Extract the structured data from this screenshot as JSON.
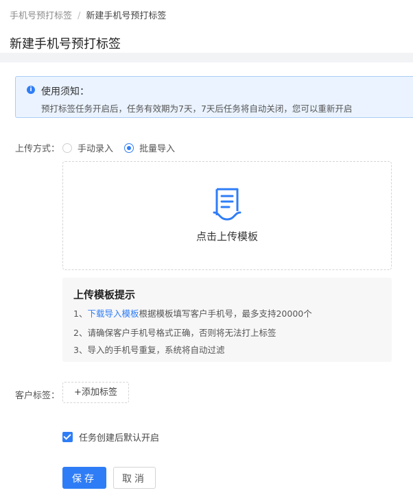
{
  "breadcrumb": {
    "parent": "手机号预打标签",
    "separator": "/",
    "current": "新建手机号预打标签"
  },
  "page_title": "新建手机号预打标签",
  "notice": {
    "icon": "info-icon",
    "title": "使用须知：",
    "text": "预打标签任务开启后，任务有效期为7天，7天后任务将自动关闭，您可以重新开启"
  },
  "upload_method": {
    "label": "上传方式：",
    "options": [
      "手动录入",
      "批量导入"
    ],
    "selected": "批量导入"
  },
  "upload_area": {
    "icon": "document-upload-icon",
    "text": "点击上传模板"
  },
  "tips": {
    "title": "上传模板提示",
    "line1_prefix": "1、",
    "line1_link": "下载导入模板",
    "line1_rest": "根据模板填写客户手机号，最多支持20000个",
    "line2": "2、请确保客户手机号格式正确，否则将无法打上标签",
    "line3": "3、导入的手机号重复，系统将自动过滤"
  },
  "customer_tag": {
    "label": "客户标签：",
    "add_button": "+添加标签"
  },
  "auto_start": {
    "label": "任务创建后默认开启",
    "checked": true
  },
  "buttons": {
    "save": "保存",
    "cancel": "取消"
  },
  "colors": {
    "primary": "#2f7df6",
    "notice_bg": "#eaf3ff",
    "notice_border": "#a9ccf5"
  }
}
